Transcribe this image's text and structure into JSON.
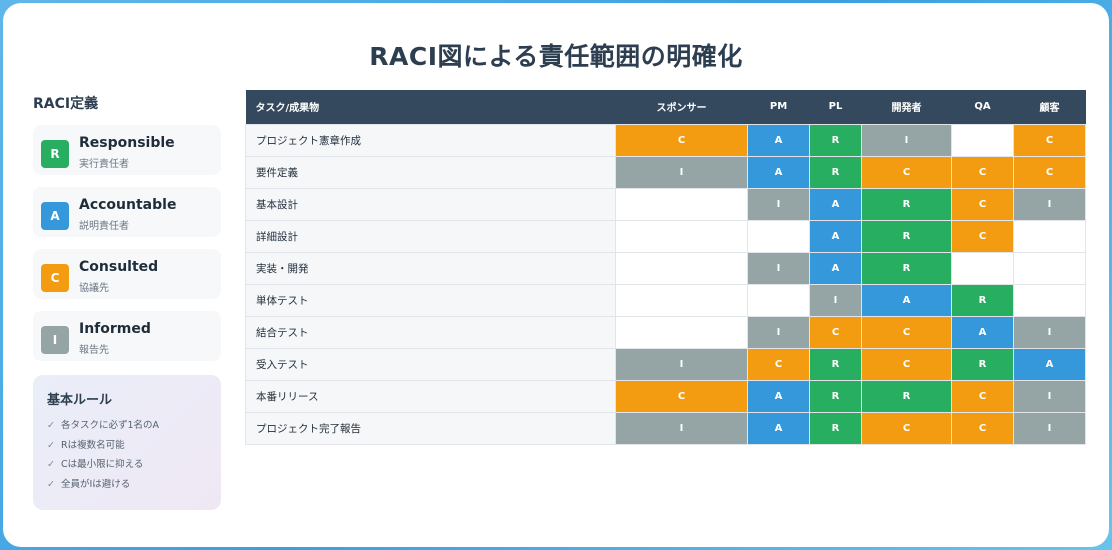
{
  "title": "RACI図による責任範囲の明確化",
  "colors": {
    "R": "#27ae60",
    "A": "#3498db",
    "C": "#f39c12",
    "I": "#95a5a6"
  },
  "legend": {
    "heading": "RACI定義",
    "items": [
      {
        "letter": "R",
        "name": "Responsible",
        "desc": "実行責任者"
      },
      {
        "letter": "A",
        "name": "Accountable",
        "desc": "説明責任者"
      },
      {
        "letter": "C",
        "name": "Consulted",
        "desc": "協議先"
      },
      {
        "letter": "I",
        "name": "Informed",
        "desc": "報告先"
      }
    ]
  },
  "rules": {
    "title": "基本ルール",
    "check_icon": "check-icon",
    "items": [
      "各タスクに必ず1名のA",
      "Rは複数名可能",
      "Cは最小限に抑える",
      "全員がIは避ける"
    ]
  },
  "table": {
    "columns": [
      "タスク/成果物",
      "スポンサー",
      "PM",
      "PL",
      "開発者",
      "QA",
      "顧客"
    ],
    "rows": [
      {
        "task": "プロジェクト憲章作成",
        "cells": [
          "C",
          "A",
          "R",
          "I",
          "",
          "C"
        ]
      },
      {
        "task": "要件定義",
        "cells": [
          "I",
          "A",
          "R",
          "C",
          "C",
          "C"
        ]
      },
      {
        "task": "基本設計",
        "cells": [
          "",
          "I",
          "A",
          "R",
          "C",
          "I"
        ]
      },
      {
        "task": "詳細設計",
        "cells": [
          "",
          "",
          "A",
          "R",
          "C",
          ""
        ]
      },
      {
        "task": "実装・開発",
        "cells": [
          "",
          "I",
          "A",
          "R",
          "",
          ""
        ]
      },
      {
        "task": "単体テスト",
        "cells": [
          "",
          "",
          "I",
          "A",
          "R",
          ""
        ]
      },
      {
        "task": "結合テスト",
        "cells": [
          "",
          "I",
          "C",
          "C",
          "A",
          "I"
        ]
      },
      {
        "task": "受入テスト",
        "cells": [
          "I",
          "C",
          "R",
          "C",
          "R",
          "A"
        ]
      },
      {
        "task": "本番リリース",
        "cells": [
          "C",
          "A",
          "R",
          "R",
          "C",
          "I"
        ]
      },
      {
        "task": "プロジェクト完了報告",
        "cells": [
          "I",
          "A",
          "R",
          "C",
          "C",
          "I"
        ]
      }
    ]
  }
}
